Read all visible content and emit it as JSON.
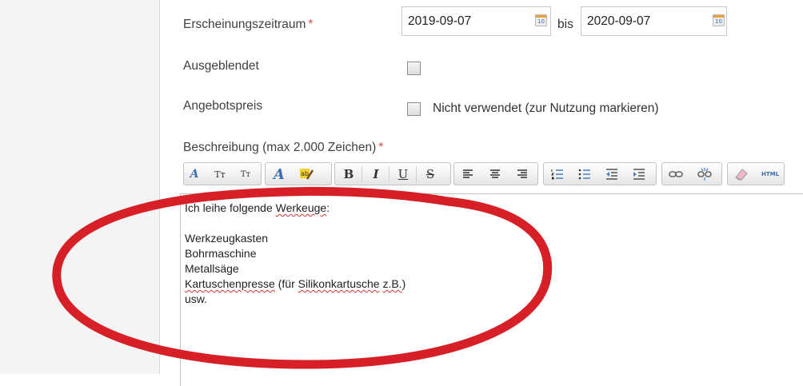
{
  "form": {
    "period": {
      "label": "Erscheinungszeitraum",
      "required_mark": "*",
      "from": "2019-09-07",
      "separator": "bis",
      "to": "2020-09-07",
      "calendar_icon_text": "10"
    },
    "hidden": {
      "label": "Ausgeblendet",
      "checked": false
    },
    "offer_price": {
      "label": "Angebotspreis",
      "checkbox_label": "Nicht verwendet (zur Nutzung markieren)",
      "checked": false
    },
    "description": {
      "label": "Beschreibung (max 2.000 Zeichen)",
      "required_mark": "*",
      "toolbar": {
        "bold": "B",
        "italic": "I",
        "underline": "U",
        "strike": "S",
        "font_size_up": "Tт",
        "font_size_down": "Tт",
        "font_name": "A",
        "html": "HTML"
      },
      "lines": {
        "l1a": "Ich leihe folgende ",
        "l1b": "Werkeuge",
        "l1c": ":",
        "l3": "Werkzeugkasten",
        "l4": "Bohrmaschine",
        "l5": "Metallsäge",
        "l6a": "Kartuschenpresse",
        "l6b": " (für ",
        "l6c": "Silikonkartusche",
        "l6d": " ",
        "l6e": "z.B.",
        "l6f": ")",
        "l7": "usw."
      }
    }
  },
  "colors": {
    "required": "#d9534f",
    "annotation": "#d61f26",
    "icon_blue": "#3b6fb0"
  }
}
